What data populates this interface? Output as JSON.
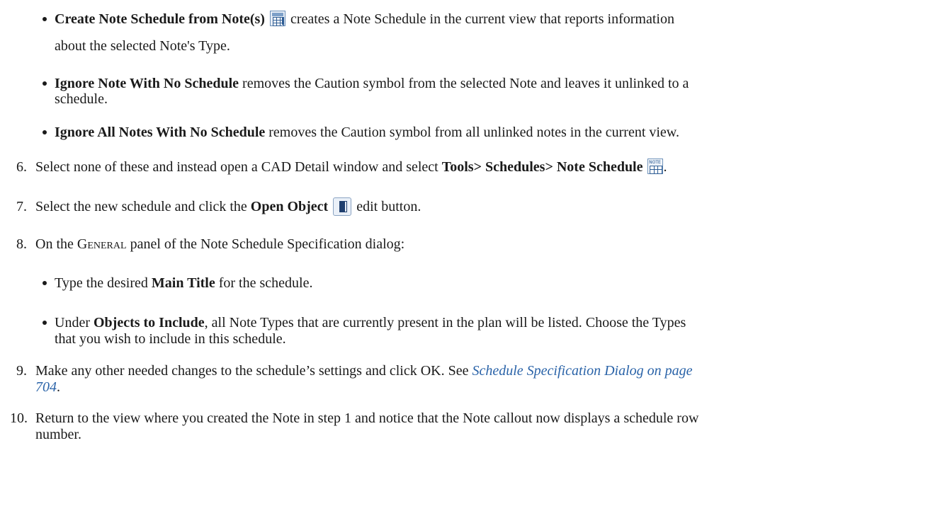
{
  "bullets_top": [
    {
      "bold": "Create Note Schedule from Note(s)",
      "icon": "schedule-from-notes-icon",
      "text_line1": " creates a Note Schedule in the current view that reports information",
      "text_line2": "about the selected Note's Type."
    },
    {
      "bold": "Ignore Note With No Schedule",
      "text_line1": " removes the Caution symbol from the selected Note and leaves it unlinked to a",
      "text_line2": "schedule."
    },
    {
      "bold": "Ignore All Notes With No Schedule",
      "text_line1": " removes the Caution symbol from all unlinked notes in the current view."
    }
  ],
  "steps": {
    "s6": {
      "num": "6.",
      "pre": "Select none of these and instead open a CAD Detail window and select ",
      "bold": "Tools> Schedules> Note Schedule",
      "icon": "note-schedule-icon",
      "icon_label": "NOTE",
      "post": "."
    },
    "s7": {
      "num": "7.",
      "pre": "Select the new schedule and click the ",
      "bold": "Open Object",
      "icon": "open-object-icon",
      "post": " edit button."
    },
    "s8": {
      "num": "8.",
      "pre": "On the ",
      "smallcaps": "General",
      "post": " panel of the Note Schedule Specification dialog:",
      "sub": [
        {
          "pre": "Type the desired ",
          "bold": "Main Title",
          "post": " for the schedule."
        },
        {
          "pre": "Under ",
          "bold": "Objects to Include",
          "post_line1": ", all Note Types that are currently present in the plan will be listed. Choose the Types",
          "post_line2": "that you wish to include in this schedule."
        }
      ]
    },
    "s9": {
      "num": "9.",
      "pre": "Make any other needed changes to the schedule’s settings and click OK. See ",
      "link_line1": "Schedule Specification Dialog on page",
      "link_line2": "704",
      "post": "."
    },
    "s10": {
      "num": "10.",
      "line1": "Return to the view where you created the Note in step 1 and notice that the Note callout now displays a schedule row",
      "line2": "number."
    }
  }
}
